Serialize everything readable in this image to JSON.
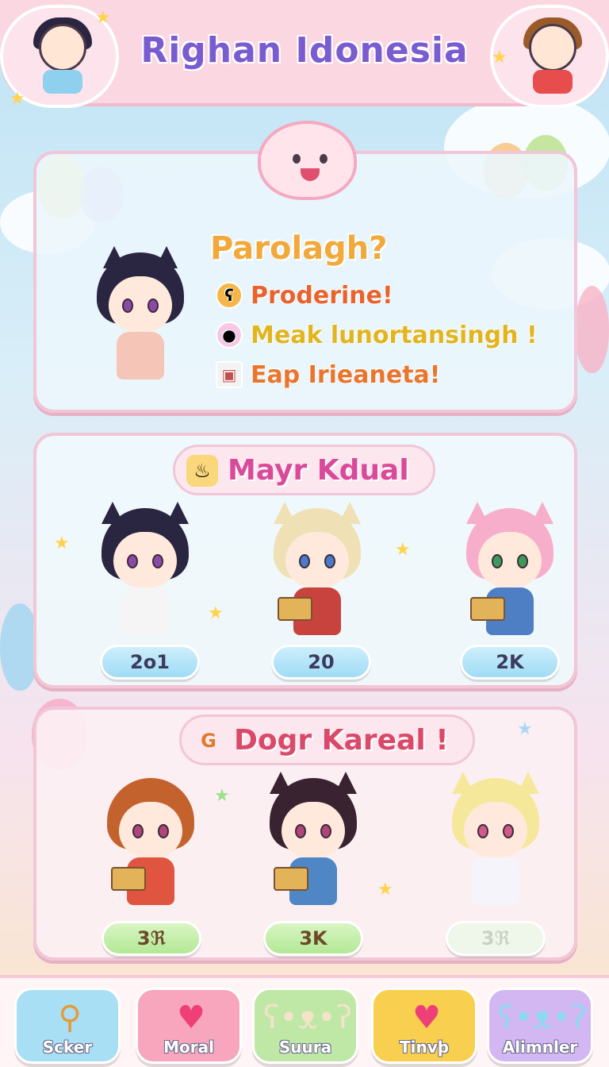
{
  "header": {
    "title": "Righan Idonesia"
  },
  "intro": {
    "heading": "Parolagh?",
    "lines": [
      {
        "text": "Proderine!",
        "icon": "bear-icon",
        "color": "#e8632e",
        "icon_bg": "#f6b64a"
      },
      {
        "text": "Meak lunortansingh !",
        "icon": "pig-icon",
        "color": "#e2b51f",
        "icon_bg": "#f7c8e5"
      },
      {
        "text": "Eap Irieaneta!",
        "icon": "picture-icon",
        "color": "#e9762d",
        "icon_bg": "#f3f3f3"
      }
    ]
  },
  "section1": {
    "title": "Mayr Kdual",
    "icon": "cup-icon",
    "cards": [
      {
        "value": "2o1"
      },
      {
        "value": "20"
      },
      {
        "value": "2K"
      }
    ]
  },
  "section2": {
    "title": "Dogr Kareal !",
    "icon": "swirl-icon",
    "cards": [
      {
        "value": "3ℜ"
      },
      {
        "value": "3K"
      },
      {
        "value": "3ℜ"
      }
    ]
  },
  "nav": [
    {
      "label": "Scker",
      "icon": "magnifier-icon",
      "color": "#a9dff5"
    },
    {
      "label": "Moral",
      "icon": "heart-icon",
      "color": "#f7a6bd"
    },
    {
      "label": "Suura",
      "icon": "bear-face-icon",
      "color": "#bfe8a6"
    },
    {
      "label": "Tinvþ",
      "icon": "heart-icon",
      "color": "#f8cf4f"
    },
    {
      "label": "Alimnler",
      "icon": "bear-face-icon",
      "color": "#d3b7f2"
    }
  ]
}
